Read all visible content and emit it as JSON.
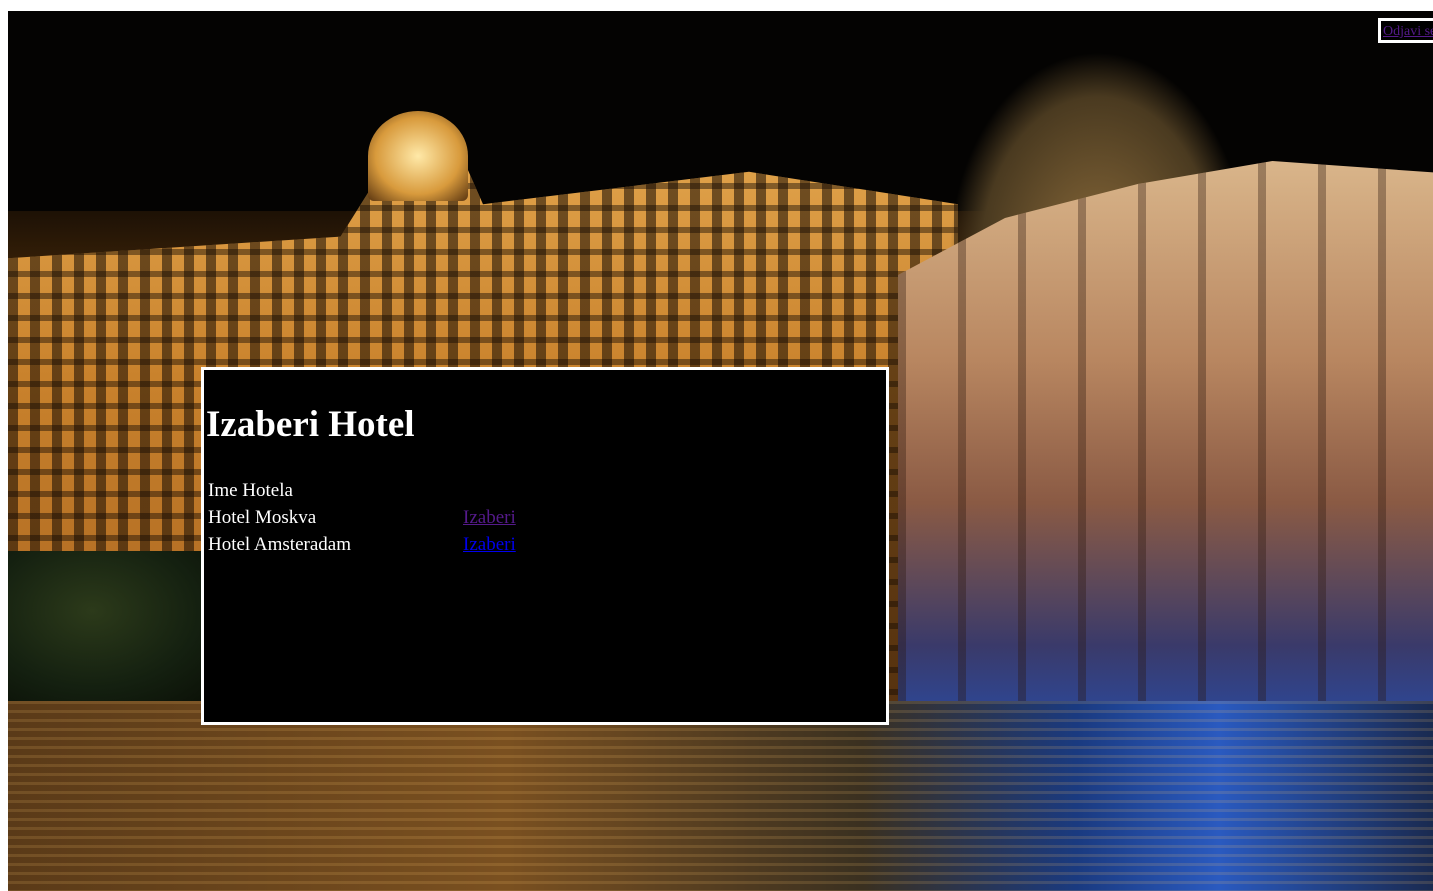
{
  "header": {
    "logout_label": "Odjavi se"
  },
  "main": {
    "title": "Izaberi Hotel",
    "column_header": "Ime Hotela",
    "hotels": [
      {
        "name": "Hotel Moskva",
        "action": "Izaberi"
      },
      {
        "name": "Hotel Amsteradam",
        "action": "Izaberi"
      }
    ]
  },
  "colors": {
    "panel_background": "#000000",
    "panel_border": "#ffffff",
    "link_visited": "#551a8b",
    "link_unvisited": "#0000ee"
  }
}
